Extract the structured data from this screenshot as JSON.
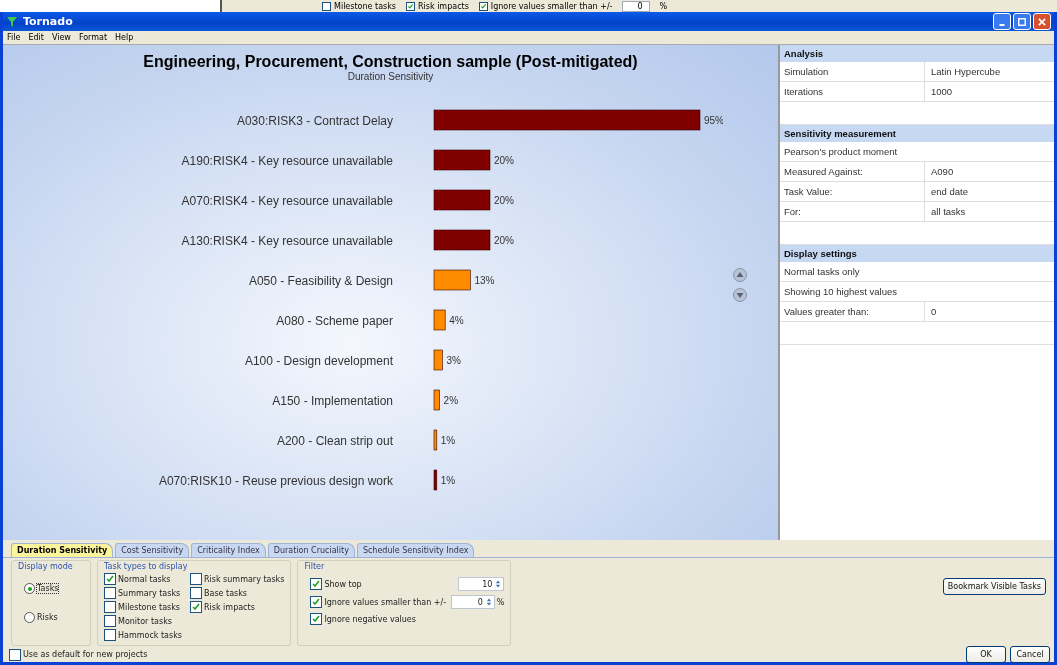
{
  "background_window": {
    "items": [
      {
        "kind": "checkbox",
        "label": "Milestone tasks",
        "checked": false
      },
      {
        "kind": "checkbox",
        "label": "Risk impacts",
        "checked": true
      },
      {
        "kind": "checkbox",
        "label": "Ignore values smaller than +/-",
        "checked": true
      },
      {
        "kind": "field",
        "label": "0"
      },
      {
        "kind": "text",
        "label": "%"
      }
    ]
  },
  "window": {
    "title": "Tornado"
  },
  "menu": [
    "File",
    "Edit",
    "View",
    "Format",
    "Help"
  ],
  "chart": {
    "title": "Engineering, Procurement, Construction sample (Post-mitigated)",
    "subtitle": "Duration Sensitivity",
    "chart_data": {
      "type": "bar",
      "orientation": "horizontal",
      "categories": [
        "A030:RISK3 - Contract Delay",
        "A190:RISK4 - Key resource unavailable",
        "A070:RISK4 - Key resource unavailable",
        "A130:RISK4 - Key resource unavailable",
        "A050 - Feasibility & Design",
        "A080 - Scheme paper",
        "A100 - Design development",
        "A150 - Implementation",
        "A200 - Clean strip out",
        "A070:RISK10 - Reuse previous design work"
      ],
      "series": [
        {
          "color": "#800000",
          "values": [
            95,
            20,
            20,
            20,
            null,
            null,
            null,
            null,
            null,
            1
          ],
          "value_labels": [
            "95%",
            "20%",
            "20%",
            "20%",
            null,
            null,
            null,
            null,
            null,
            "1%"
          ]
        },
        {
          "color": "#ff8c00",
          "values": [
            null,
            null,
            null,
            null,
            13,
            4,
            3,
            2,
            1,
            null
          ],
          "value_labels": [
            null,
            null,
            null,
            null,
            "13%",
            "4%",
            "3%",
            "2%",
            "1%",
            null
          ]
        }
      ]
    }
  },
  "panel": {
    "sections": [
      {
        "title": "Analysis",
        "rows": [
          {
            "label": "Simulation",
            "value": "Latin Hypercube"
          },
          {
            "label": "Iterations",
            "value": "1000"
          }
        ]
      },
      {
        "title": "Sensitivity measurement",
        "rows": [
          {
            "label": "Pearson's product moment"
          },
          {
            "label": "Measured Against:",
            "value": "A090"
          },
          {
            "label": "Task Value:",
            "value": "end date"
          },
          {
            "label": "For:",
            "value": "all tasks"
          }
        ]
      },
      {
        "title": "Display settings",
        "rows": [
          {
            "label": "Normal tasks only"
          },
          {
            "label": "Showing 10 highest values"
          },
          {
            "label": "Values greater than:",
            "value": "0"
          }
        ]
      }
    ]
  },
  "tabs": [
    {
      "label": "Duration Sensitivity",
      "selected": true
    },
    {
      "label": "Cost Sensitivity",
      "selected": false
    },
    {
      "label": "Criticality Index",
      "selected": false
    },
    {
      "label": "Duration Cruciality",
      "selected": false
    },
    {
      "label": "Schedule Sensitivity Index",
      "selected": false
    }
  ],
  "display_mode": {
    "title": "Display mode",
    "options": [
      {
        "label": "Tasks",
        "selected": true
      },
      {
        "label": "Risks",
        "selected": false
      }
    ]
  },
  "task_types": {
    "title": "Task types to display",
    "columns": [
      [
        {
          "label": "Normal tasks",
          "checked": true
        },
        {
          "label": "Summary tasks",
          "checked": false
        },
        {
          "label": "Milestone tasks",
          "checked": false
        },
        {
          "label": "Monitor tasks",
          "checked": false
        },
        {
          "label": "Hammock tasks",
          "checked": false
        }
      ],
      [
        {
          "label": "Risk summary tasks",
          "checked": false
        },
        {
          "label": "Base tasks",
          "checked": false
        },
        {
          "label": "Risk impacts",
          "checked": true
        }
      ]
    ]
  },
  "filter": {
    "title": "Filter",
    "rows": [
      {
        "label": "Show top",
        "checked": true,
        "value": "10"
      },
      {
        "label": "Ignore values smaller than +/-",
        "checked": true,
        "value": "0",
        "unit": "%"
      },
      {
        "label": "Ignore negative values",
        "checked": true
      }
    ]
  },
  "default_option": {
    "label": "Use as default for new projects",
    "checked": false
  },
  "buttons": {
    "bookmark": "Bookmark Visible Tasks",
    "ok": "OK",
    "cancel": "Cancel"
  }
}
